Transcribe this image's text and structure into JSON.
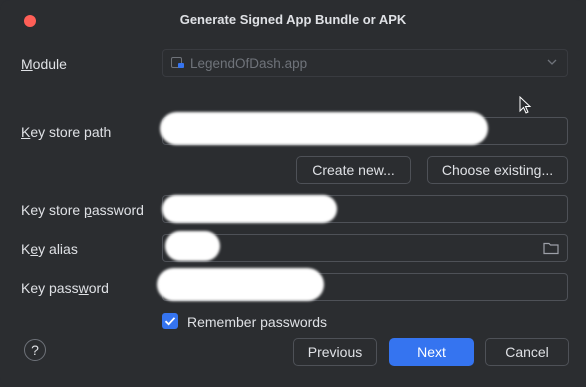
{
  "window": {
    "title": "Generate Signed App Bundle or APK"
  },
  "form": {
    "module_label": "Module",
    "module_value": "LegendOfDash.app",
    "keystore_path_label": "Key store path",
    "create_new_label": "Create new...",
    "choose_existing_label": "Choose existing...",
    "keystore_password_label": "Key store password",
    "key_alias_label": "Key alias",
    "key_password_label": "Key password",
    "remember_label": "Remember passwords",
    "remember_checked": true
  },
  "buttons": {
    "help": "?",
    "previous": "Previous",
    "next": "Next",
    "cancel": "Cancel"
  },
  "colors": {
    "background": "#2b2d30",
    "accent": "#3574f0",
    "close": "#ff5f57"
  },
  "icons": [
    "close-icon",
    "module-icon",
    "chevron-down-icon",
    "folder-icon",
    "check-icon",
    "help-icon",
    "cursor-icon"
  ]
}
